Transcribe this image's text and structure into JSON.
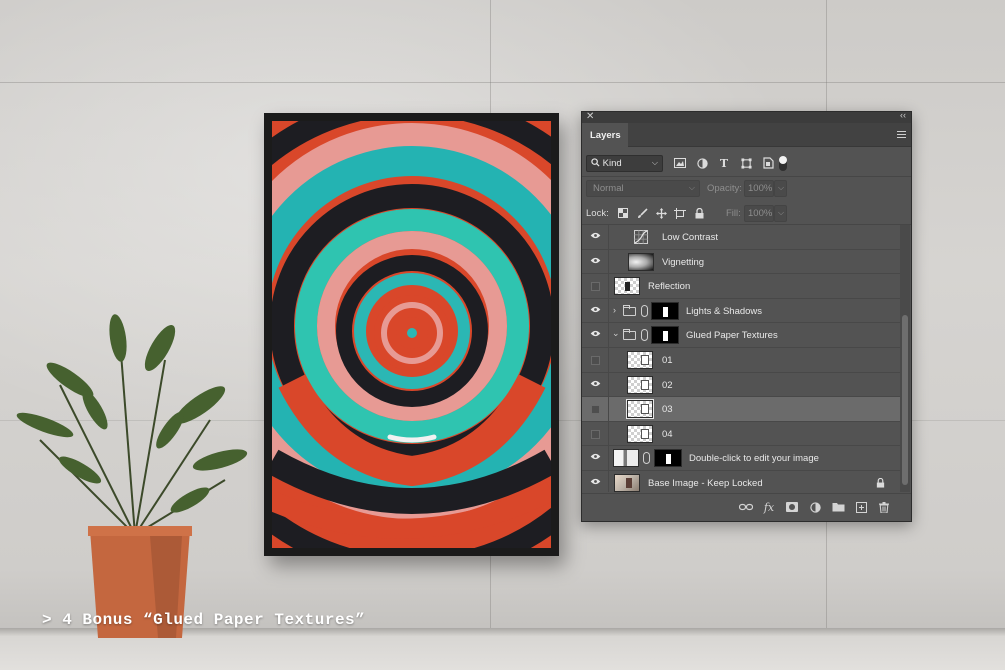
{
  "caption": "> 4 Bonus “Glued Paper Textures”",
  "panel": {
    "title_tab": "Layers",
    "close_glyph": "✕",
    "collapse_glyph": "‹‹",
    "filter": {
      "kind_label": "Kind",
      "search_icon": "search-icon"
    },
    "blend_mode": "Normal",
    "opacity_label": "Opacity:",
    "opacity_value": "100%",
    "lock_label": "Lock:",
    "fill_label": "Fill:",
    "fill_value": "100%"
  },
  "layers": [
    {
      "name": "Low Contrast",
      "visible": true,
      "type": "adjustment-curves"
    },
    {
      "name": "Vignetting",
      "visible": true,
      "type": "gradient"
    },
    {
      "name": "Reflection",
      "visible": false,
      "type": "smart-object"
    },
    {
      "name": "Lights & Shadows",
      "visible": true,
      "type": "group-collapsed"
    },
    {
      "name": "Glued Paper Textures",
      "visible": true,
      "type": "group-expanded"
    },
    {
      "name": "01",
      "visible": false,
      "type": "texture"
    },
    {
      "name": "02",
      "visible": true,
      "type": "texture"
    },
    {
      "name": "03",
      "visible": false,
      "type": "texture",
      "selected": true
    },
    {
      "name": "04",
      "visible": false,
      "type": "texture"
    },
    {
      "name": "Double-click to edit your image",
      "visible": true,
      "type": "smart-masked"
    },
    {
      "name": "Base Image - Keep Locked",
      "visible": true,
      "type": "locked"
    }
  ],
  "colors": {
    "panel_bg": "#535353",
    "selected_row": "#6b6b6b",
    "poster_red": "#d84a24",
    "poster_teal": "#2bb7b4",
    "poster_pink": "#e79a94"
  }
}
